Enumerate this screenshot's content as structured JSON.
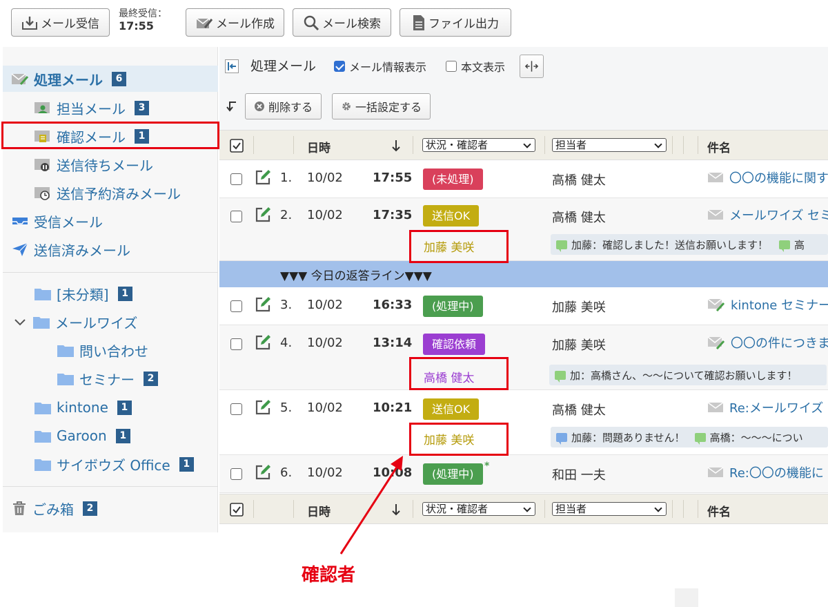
{
  "toolbar": {
    "receive_label": "メール受信",
    "last_received_label": "最終受信：",
    "last_received_time": "17:55",
    "compose_label": "メール作成",
    "search_label": "メール検索",
    "export_label": "ファイル出力"
  },
  "sidebar": {
    "processing": {
      "label": "処理メール",
      "count": "6"
    },
    "assigned": {
      "label": "担当メール",
      "count": "3"
    },
    "confirm": {
      "label": "確認メール",
      "count": "1"
    },
    "waiting": {
      "label": "送信待ちメール"
    },
    "scheduled": {
      "label": "送信予約済みメール"
    },
    "inbox": {
      "label": "受信メール"
    },
    "sent": {
      "label": "送信済みメール"
    },
    "folders": [
      {
        "label": "[未分類]",
        "count": "1"
      },
      {
        "label": "メールワイズ"
      },
      {
        "label": "問い合わせ"
      },
      {
        "label": "セミナー",
        "count": "2"
      },
      {
        "label": "kintone",
        "count": "1"
      },
      {
        "label": "Garoon",
        "count": "1"
      },
      {
        "label": "サイボウズ Office",
        "count": "1"
      }
    ],
    "trash": {
      "label": "ごみ箱",
      "count": "2"
    }
  },
  "main": {
    "title": "処理メール",
    "show_info_label": "メール情報表示",
    "show_body_label": "本文表示",
    "delete_label": "削除する",
    "bulk_label": "一括設定する",
    "header": {
      "datetime": "日時",
      "status_select": "状況・確認者",
      "assignee_select": "担当者",
      "subject": "件名"
    },
    "rows": [
      {
        "num": "1.",
        "date": "10/02",
        "time": "17:55",
        "status": "(未処理)",
        "status_color": "#d9405b",
        "assignee": "高橋 健太",
        "subject": "〇〇の機能に関す"
      },
      {
        "num": "2.",
        "date": "10/02",
        "time": "17:35",
        "status": "送信OK",
        "status_color": "#c3ad12",
        "confirmer": "加藤 美咲",
        "assignee": "高橋 健太",
        "subject": "メールワイズ セミ",
        "memo1": "加藤：確認しました！送信お願いします！",
        "memo2": "高"
      },
      {
        "num": "3.",
        "date": "10/02",
        "time": "16:33",
        "status": "(処理中)",
        "status_color": "#4b9e4f",
        "assignee": "加藤 美咲",
        "subject": "kintone セミナー"
      },
      {
        "num": "4.",
        "date": "10/02",
        "time": "13:14",
        "status": "確認依頼",
        "status_color": "#9b3ed1",
        "confirmer": "高橋 健太",
        "assignee": "加藤 美咲",
        "subject": "〇〇の件につきま",
        "memo1": "加：高橋さん、〜〜について確認お願いします！"
      },
      {
        "num": "5.",
        "date": "10/02",
        "time": "10:21",
        "status": "送信OK",
        "status_color": "#c3ad12",
        "confirmer": "加藤 美咲",
        "assignee": "高橋 健太",
        "subject": "Re:メールワイズ",
        "memo1": "加藤：問題ありません！",
        "memo2": "高橋：〜〜〜につい"
      },
      {
        "num": "6.",
        "date": "10/02",
        "time": "10:08",
        "status": "(処理中)",
        "status_color": "#4b9e4f",
        "status_mark": "*",
        "assignee": "和田 一夫",
        "subject": "Re:〇〇の機能に"
      }
    ],
    "reply_line": "▼▼▼ 今日の返答ライン▼▼▼"
  },
  "annotation": {
    "label": "確認者",
    "color": "#e60012"
  }
}
